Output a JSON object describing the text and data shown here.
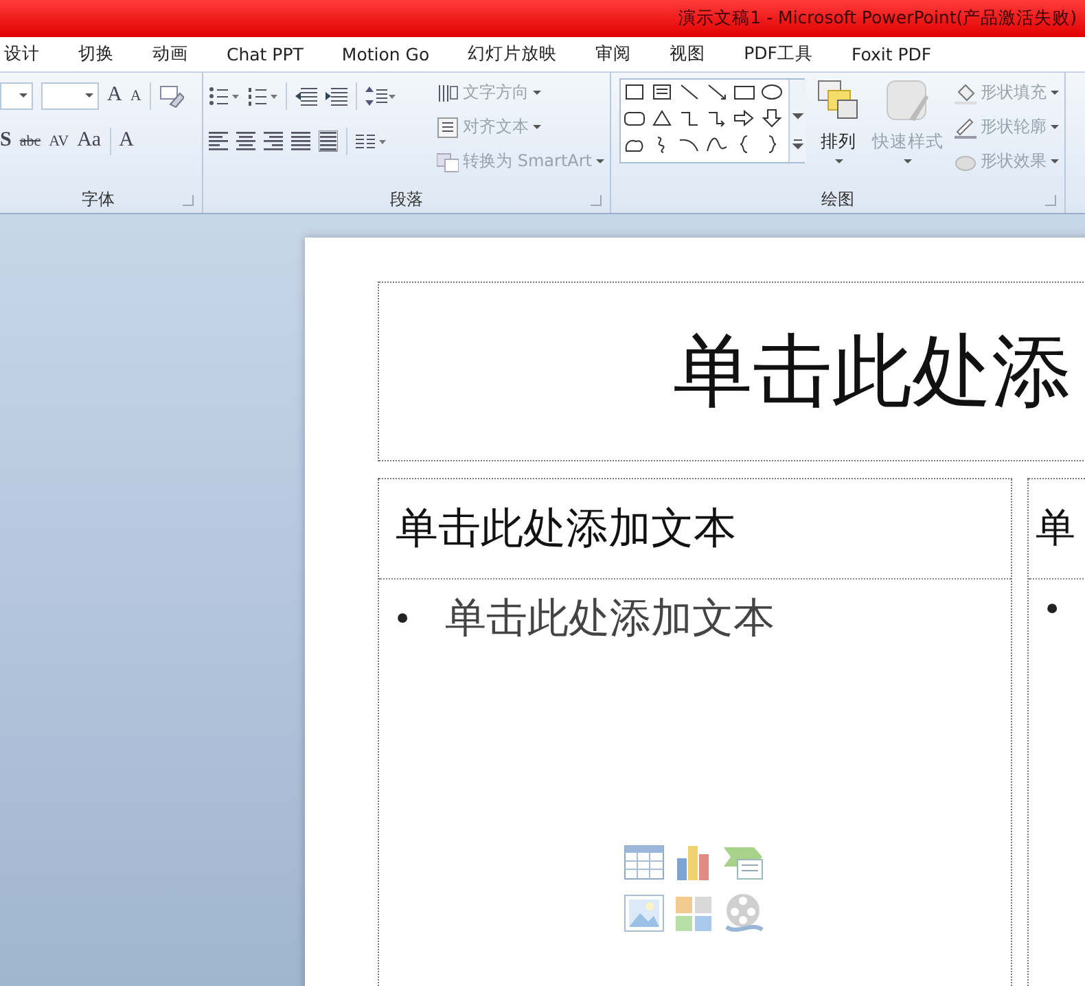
{
  "window": {
    "title": "演示文稿1 - Microsoft PowerPoint(产品激活失败)"
  },
  "tabs": [
    {
      "label": "设计",
      "selected": false
    },
    {
      "label": "切换",
      "selected": false
    },
    {
      "label": "动画",
      "selected": false
    },
    {
      "label": "Chat PPT",
      "selected": false
    },
    {
      "label": "Motion Go",
      "selected": false
    },
    {
      "label": "幻灯片放映",
      "selected": false
    },
    {
      "label": "审阅",
      "selected": false
    },
    {
      "label": "视图",
      "selected": false
    },
    {
      "label": "PDF工具",
      "selected": false
    },
    {
      "label": "Foxit PDF",
      "selected": false
    }
  ],
  "ribbon": {
    "font_group": {
      "label": "字体",
      "grow_glyph": "A",
      "shrink_glyph": "A",
      "row2": [
        "S",
        "abc",
        "AV",
        "Aa",
        "A"
      ]
    },
    "paragraph_group": {
      "label": "段落",
      "commands": [
        {
          "label": "文字方向",
          "disabled": true
        },
        {
          "label": "对齐文本",
          "disabled": true
        },
        {
          "label": "转换为 SmartArt",
          "disabled": true
        }
      ]
    },
    "drawing_group": {
      "label": "绘图",
      "big_buttons": [
        {
          "label": "排列",
          "disabled": false
        },
        {
          "label": "快速样式",
          "disabled": true
        }
      ],
      "commands": [
        {
          "label": "形状填充",
          "disabled": true
        },
        {
          "label": "形状轮廓",
          "disabled": true
        },
        {
          "label": "形状效果",
          "disabled": true
        }
      ]
    }
  },
  "slide": {
    "title_placeholder": "单击此处添",
    "content_placeholders": [
      {
        "heading": "单击此处添加文本",
        "bullet_mark": "•",
        "bullet": "单击此处添加文本",
        "insert_icons": true
      },
      {
        "heading": "单",
        "bullet_mark": "•"
      }
    ]
  }
}
